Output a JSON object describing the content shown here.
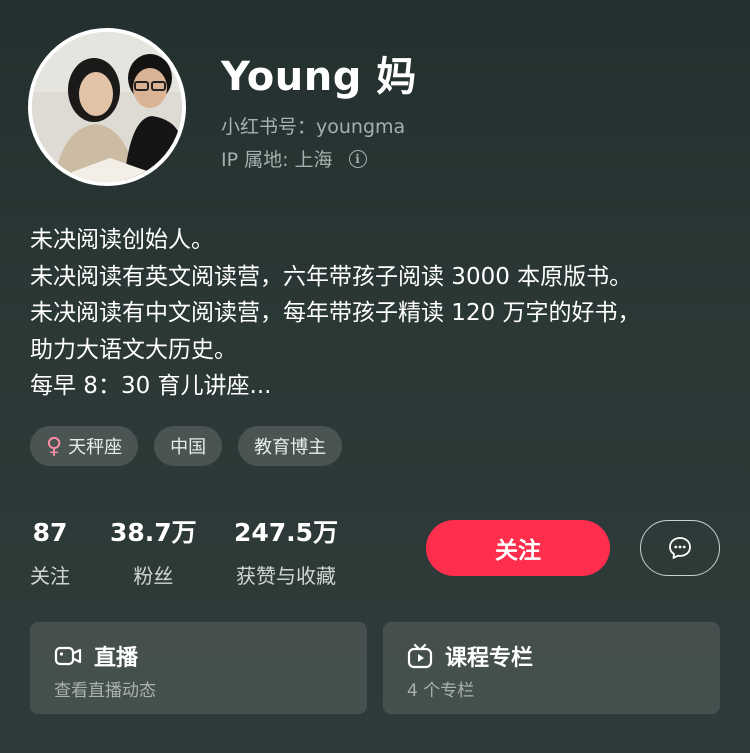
{
  "profile": {
    "name": "Young 妈",
    "red_id": "小红书号：youngma",
    "ip_location": "IP 属地: 上海"
  },
  "bio": [
    "未决阅读创始人。",
    "未决阅读有英文阅读营，六年带孩子阅读 3000 本原版书。",
    "未决阅读有中文阅读营，每年带孩子精读 120 万字的好书，",
    "助力大语文大历史。",
    "每早 8：30 育儿讲座..."
  ],
  "tags": [
    {
      "icon": "female-icon",
      "label": "天秤座"
    },
    {
      "label": "中国"
    },
    {
      "label": "教育博主"
    }
  ],
  "stats": [
    {
      "value": "87",
      "label": "关注"
    },
    {
      "value": "38.7万",
      "label": "粉丝"
    },
    {
      "value": "247.5万",
      "label": "获赞与收藏"
    }
  ],
  "actions": {
    "follow_label": "关注",
    "message_icon": "chat-bubble-icon"
  },
  "cards": [
    {
      "icon": "video-camera-icon",
      "title": "直播",
      "subtitle": "查看直播动态"
    },
    {
      "icon": "tv-play-icon",
      "title": "课程专栏",
      "subtitle": "4 个专栏"
    }
  ],
  "colors": {
    "background": "#2b3836",
    "follow_button": "#ff2e4d",
    "secondary_text": "#a6b0ae",
    "female_icon": "#ff8fa6"
  }
}
